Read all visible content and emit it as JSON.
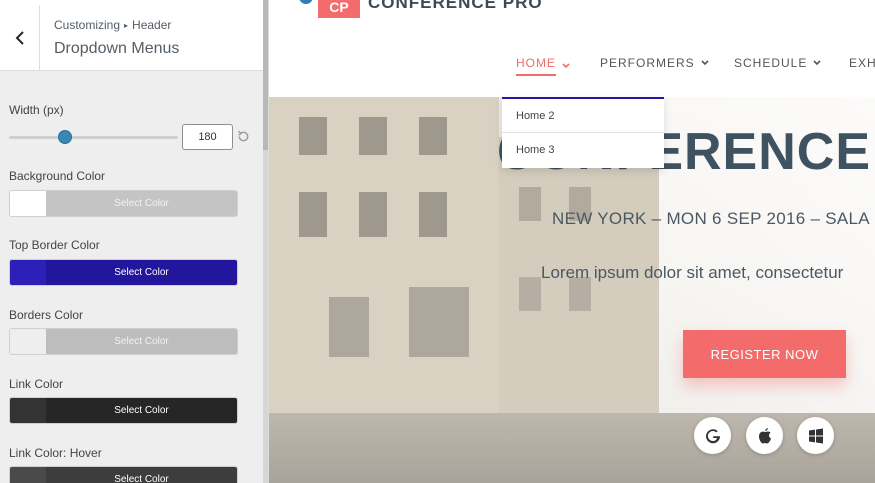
{
  "panel": {
    "breadcrumb": {
      "parent": "Customizing",
      "section": "Header",
      "separator": "▸"
    },
    "title": "Dropdown Menus",
    "width": {
      "label": "Width (px)",
      "value": "180",
      "slider_fraction": 0.33
    },
    "colors": [
      {
        "label": "Background Color",
        "button_label": "Select Color",
        "swatch": "#ffffff",
        "fill": "#c4c4c4",
        "text_color": "#f2f2f2"
      },
      {
        "label": "Top Border Color",
        "button_label": "Select Color",
        "swatch": "#2d20b8",
        "fill": "#22169c",
        "text_color": "#ffffff"
      },
      {
        "label": "Borders Color",
        "button_label": "Select Color",
        "swatch": "#eeeeee",
        "fill": "#bdbdbd",
        "text_color": "#f2f2f2"
      },
      {
        "label": "Link Color",
        "button_label": "Select Color",
        "swatch": "#333333",
        "fill": "#262626",
        "text_color": "#ffffff"
      },
      {
        "label": "Link Color: Hover",
        "button_label": "Select Color",
        "swatch": "#4a4a4a",
        "fill": "#3d3d3d",
        "text_color": "#ffffff"
      }
    ]
  },
  "preview": {
    "logo": {
      "mark": "CP",
      "text": "CONFERENCE PRO"
    },
    "nav": [
      {
        "label": "HOME",
        "active": true
      },
      {
        "label": "PERFORMERS",
        "active": false
      },
      {
        "label": "SCHEDULE",
        "active": false
      },
      {
        "label": "EXH",
        "active": false
      }
    ],
    "dropdown": [
      "Home 2",
      "Home 3"
    ],
    "hero": {
      "title": "CONFERENCE",
      "subtitle": "NEW YORK – MON 6 SEP 2016 – SALA",
      "lorem": "Lorem ipsum dolor sit amet, consectetur",
      "cta": "REGISTER NOW"
    },
    "store_icons": [
      "google-icon",
      "apple-icon",
      "windows-icon"
    ]
  },
  "colors": {
    "accent": "#f36b6b",
    "brand_blue": "#2f7fb5",
    "dropdown_border": "#23189e",
    "text_dark": "#3f525f"
  }
}
